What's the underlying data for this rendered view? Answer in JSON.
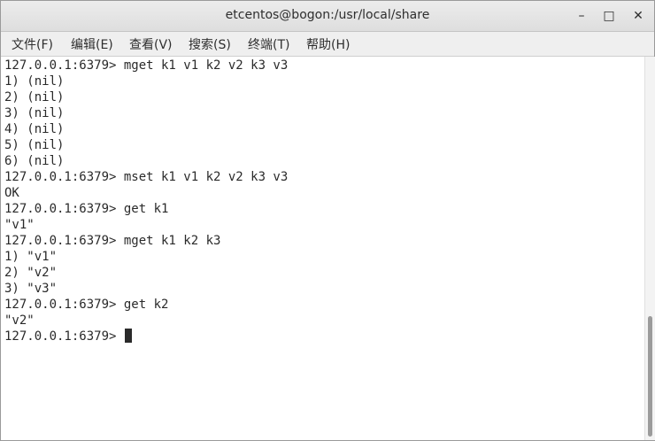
{
  "window": {
    "title": "etcentos@bogon:/usr/local/share",
    "controls": {
      "minimize": "–",
      "maximize": "□",
      "close": "✕"
    }
  },
  "menu": [
    "文件(F)",
    "编辑(E)",
    "查看(V)",
    "搜索(S)",
    "终端(T)",
    "帮助(H)"
  ],
  "terminal": {
    "lines": [
      "127.0.0.1:6379> mget k1 v1 k2 v2 k3 v3",
      "1) (nil)",
      "2) (nil)",
      "3) (nil)",
      "4) (nil)",
      "5) (nil)",
      "6) (nil)",
      "127.0.0.1:6379> mset k1 v1 k2 v2 k3 v3",
      "OK",
      "127.0.0.1:6379> get k1",
      "\"v1\"",
      "127.0.0.1:6379> mget k1 k2 k3",
      "1) \"v1\"",
      "2) \"v2\"",
      "3) \"v3\"",
      "127.0.0.1:6379> get k2",
      "\"v2\""
    ],
    "prompt": "127.0.0.1:6379> "
  }
}
